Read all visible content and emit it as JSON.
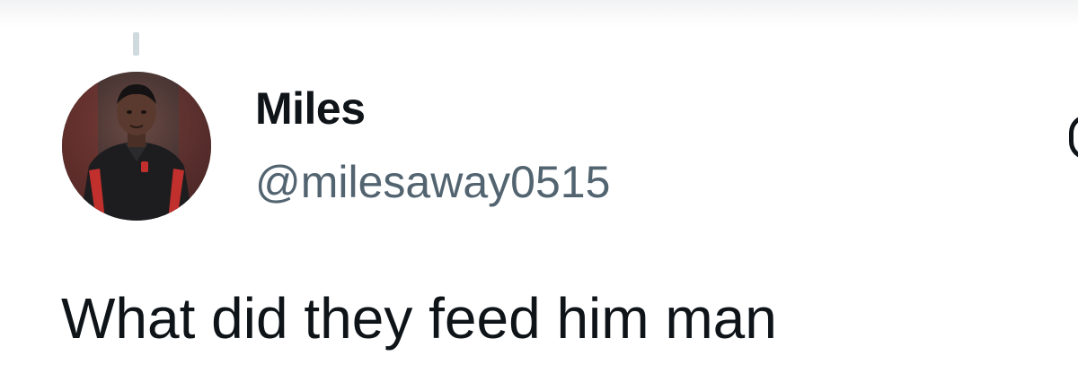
{
  "tweet": {
    "author": {
      "display_name": "Miles",
      "handle": "@milesaway0515"
    },
    "text": "What did they feed him man"
  },
  "icons": {
    "avatar": "profile-photo",
    "more": "more-options-icon"
  },
  "colors": {
    "text_primary": "#0f1419",
    "text_secondary": "#536471",
    "thread_line": "#cfd9de"
  }
}
